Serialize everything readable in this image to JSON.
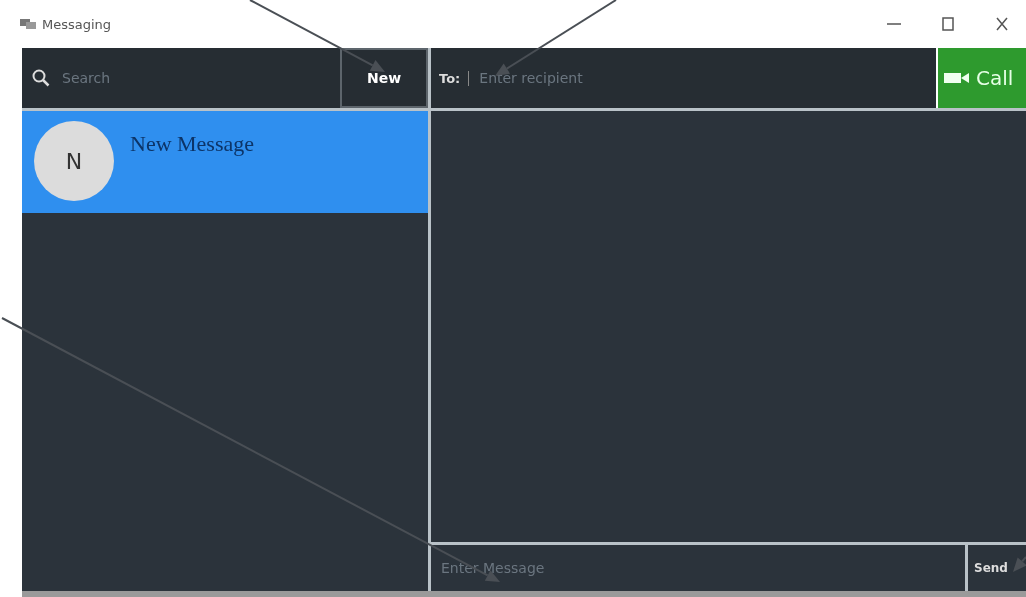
{
  "window": {
    "title": "Messaging"
  },
  "search": {
    "placeholder": "Search"
  },
  "new_button": {
    "label": "New"
  },
  "conversations": [
    {
      "avatar": "N",
      "name": "New Message",
      "selected": true
    }
  ],
  "recipient": {
    "label": "To:",
    "placeholder": "Enter recipient"
  },
  "call_button": {
    "label": "Call"
  },
  "message": {
    "placeholder": "Enter Message"
  },
  "send_button": {
    "label": "Send"
  }
}
